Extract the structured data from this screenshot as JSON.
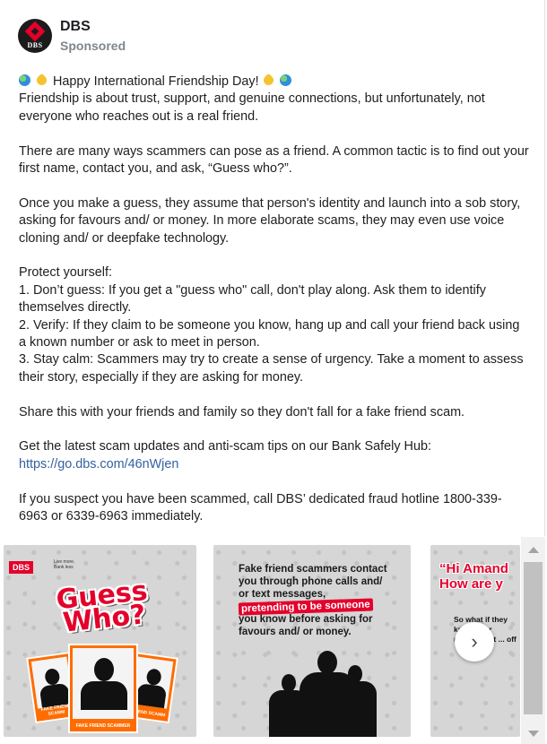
{
  "post": {
    "page_name": "DBS",
    "sponsored": "Sponsored",
    "avatar_text": "DBS",
    "lines": [
      "Happy International Friendship Day!",
      "Friendship is about trust, support, and genuine connections, but unfortunately, not everyone who reaches out is a real friend.",
      "There are many ways scammers can pose as a friend. A common tactic is to find out your first name, contact you, and ask, “Guess who?”.",
      "Once you make a guess, they assume that person's identity and launch into a sob story, asking for favours and/ or money. In more elaborate scams, they may even use voice cloning and/ or deepfake technology.",
      "Protect yourself:",
      "1. Don’t guess: If you get a \"guess who\" call, don't play along. Ask them to identify themselves directly.",
      "2. Verify: If they claim to be someone you know, hang up and call your friend back using a known number or ask to meet in person.",
      "3. Stay calm: Scammers may try to create a sense of urgency. Take a moment to assess their story, especially if they are asking for money.",
      "Share this with your friends and family so they don't fall for a fake friend scam.",
      "Get the latest scam updates and anti-scam tips on our Bank Safely Hub:",
      "https://go.dbs.com/46nWjen",
      "If you suspect you have been scammed, call DBS’ dedicated fraud hotline 1800-339-6963 or 6339-6963 immediately."
    ]
  },
  "carousel": {
    "card1": {
      "logo": "DBS",
      "logo_sub": "Live more, Bank less",
      "headline": "Guess Who?",
      "label_left": "FAKE FRIEND SCAMM",
      "label_center": "FAKE FRIEND SCAMMER",
      "label_right": "FRIEND SCAMM"
    },
    "card2": {
      "text_before": "Fake friend scammers contact you through phone calls and/ or text messages,",
      "highlight": "pretending to be someone",
      "text_after": "you know before asking for favours and/ or money."
    },
    "card3": {
      "title_line1": "“Hi Amand",
      "title_line2": "How are y",
      "body": "So what if they know your name... that ... off"
    },
    "next_icon": "chevron-right-icon"
  },
  "colors": {
    "brand_red": "#e4002b",
    "link_blue": "#33619e",
    "accent_orange": "#ff6c00"
  }
}
